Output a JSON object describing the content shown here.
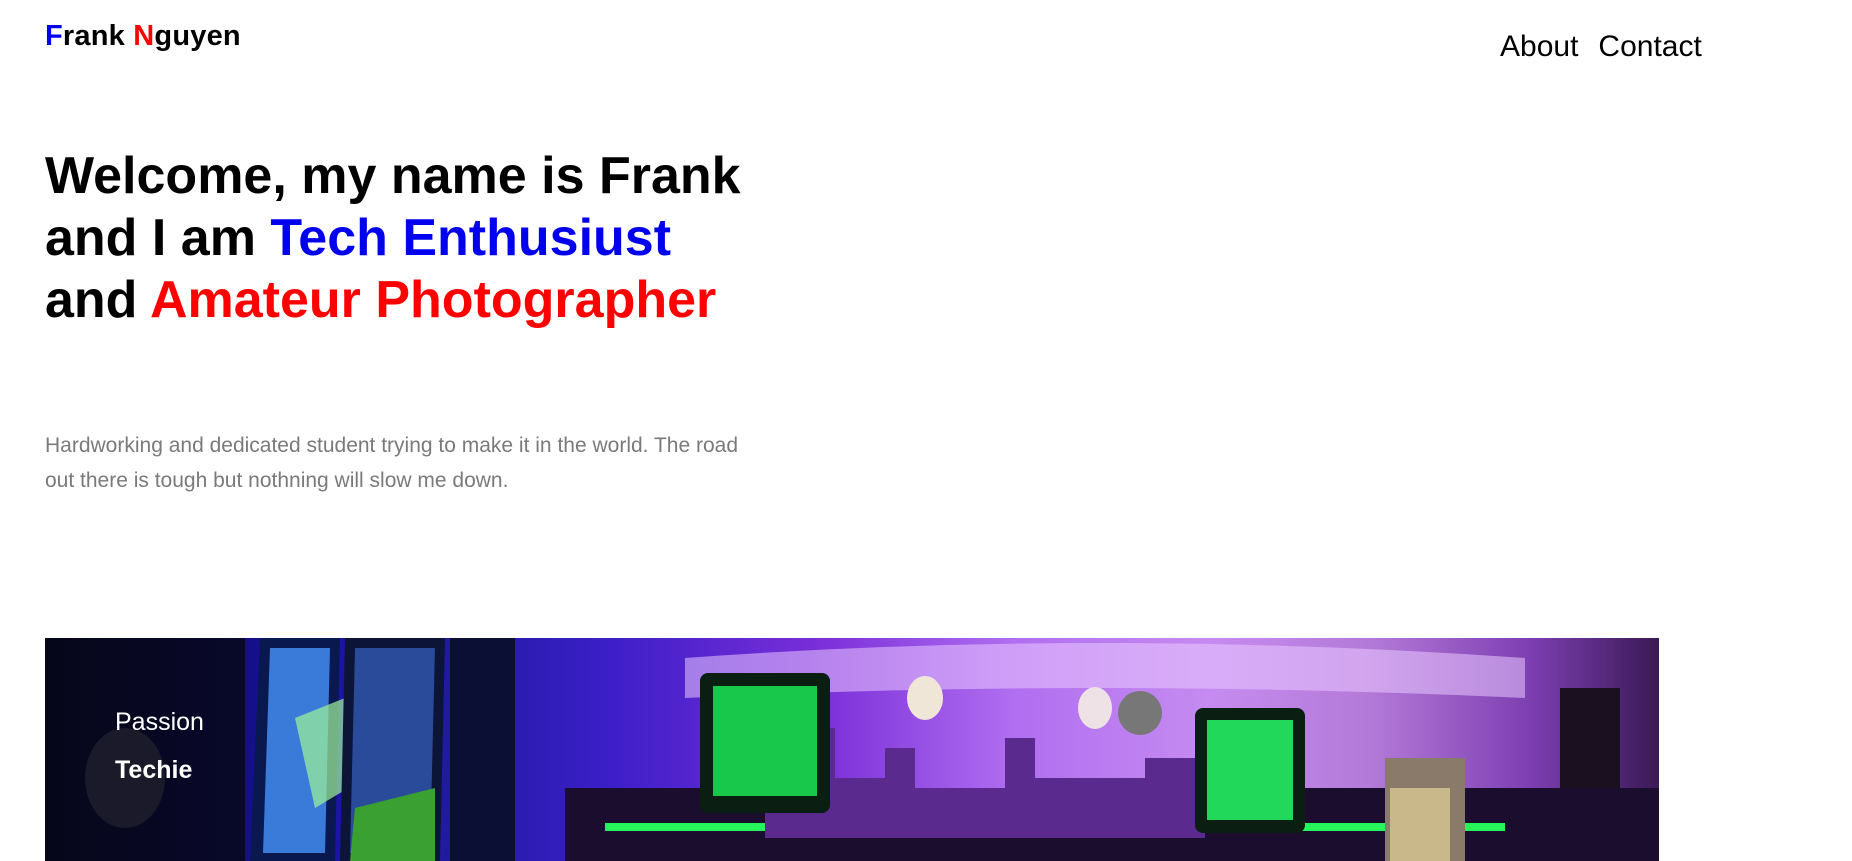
{
  "header": {
    "logo_first_initial": "F",
    "logo_first_rest": "rank ",
    "logo_last_initial": "N",
    "logo_last_rest": "guyen",
    "nav": {
      "about": "About",
      "contact": "Contact"
    }
  },
  "hero": {
    "part1": "Welcome, my name is Frank and I am ",
    "highlight1": "Tech Enthusiust",
    "part2": " and ",
    "highlight2": "Amateur Photographer",
    "subtitle": "Hardworking and dedicated student trying to make it in the world. The road out there is tough but nothning will slow me down."
  },
  "banner": {
    "label": "Passion",
    "title": "Techie",
    "image": "gaming-setup-photo"
  },
  "colors": {
    "accent_blue": "#0000ee",
    "accent_red": "#ff0000",
    "subtitle_gray": "#7a7a7a"
  }
}
